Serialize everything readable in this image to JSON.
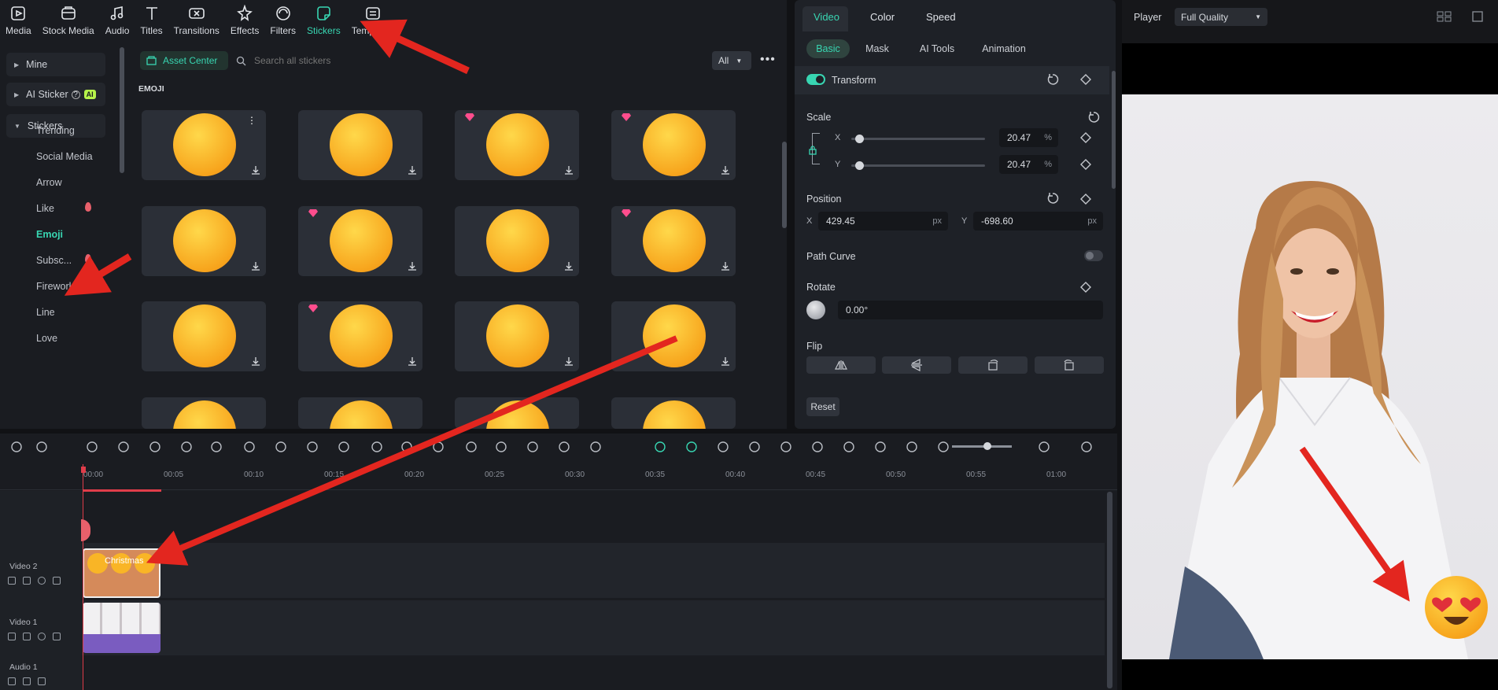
{
  "top_tabs": [
    {
      "label": "Media",
      "icon": "media-icon",
      "active": false
    },
    {
      "label": "Stock Media",
      "icon": "stock-media-icon",
      "active": false
    },
    {
      "label": "Audio",
      "icon": "audio-icon",
      "active": false
    },
    {
      "label": "Titles",
      "icon": "titles-icon",
      "active": false
    },
    {
      "label": "Transitions",
      "icon": "transitions-icon",
      "active": false
    },
    {
      "label": "Effects",
      "icon": "effects-icon",
      "active": false
    },
    {
      "label": "Filters",
      "icon": "filters-icon",
      "active": false
    },
    {
      "label": "Stickers",
      "icon": "stickers-icon",
      "active": true
    },
    {
      "label": "Templates",
      "icon": "templates-icon",
      "active": false
    }
  ],
  "sidebar": {
    "heads": [
      "Mine",
      "AI Sticker",
      "Stickers"
    ],
    "ai_badge": "AI",
    "items": [
      "Trending",
      "Social Media",
      "Arrow",
      "Like",
      "Emoji",
      "Subsc...",
      "Firework",
      "Line",
      "Love"
    ],
    "active_item": "Emoji"
  },
  "content": {
    "asset_center": "Asset Center",
    "search_placeholder": "Search all stickers",
    "filter_value": "All",
    "section_title": "EMOJI"
  },
  "properties": {
    "tabs": [
      "Video",
      "Color",
      "Speed"
    ],
    "subtabs": [
      "Basic",
      "Mask",
      "AI Tools",
      "Animation"
    ],
    "transform_label": "Transform",
    "scale_label": "Scale",
    "scale_x_axis": "X",
    "scale_y_axis": "Y",
    "scale_x": "20.47",
    "scale_y": "20.47",
    "percent": "%",
    "position_label": "Position",
    "pos_x_axis": "X",
    "pos_y_axis": "Y",
    "pos_x": "429.45",
    "pos_y": "-698.60",
    "px": "px",
    "path_curve_label": "Path Curve",
    "rotate_label": "Rotate",
    "rotate_value": "0.00°",
    "flip_label": "Flip",
    "reset_label": "Reset"
  },
  "player": {
    "label": "Player",
    "quality": "Full Quality"
  },
  "timeline": {
    "ruler": [
      "00:00",
      "00:05",
      "00:10",
      "00:15",
      "00:20",
      "00:25",
      "00:30",
      "00:35",
      "00:40",
      "00:45",
      "00:50",
      "00:55",
      "01:00"
    ],
    "tracks": [
      "Video 2",
      "Video 1",
      "Audio 1"
    ],
    "clip_label": "Christmas"
  },
  "colors": {
    "accent": "#38d6b2",
    "arrow": "#e3261f",
    "clip_video": "#7a5cc0",
    "clip_sticker": "#d58a5a"
  }
}
